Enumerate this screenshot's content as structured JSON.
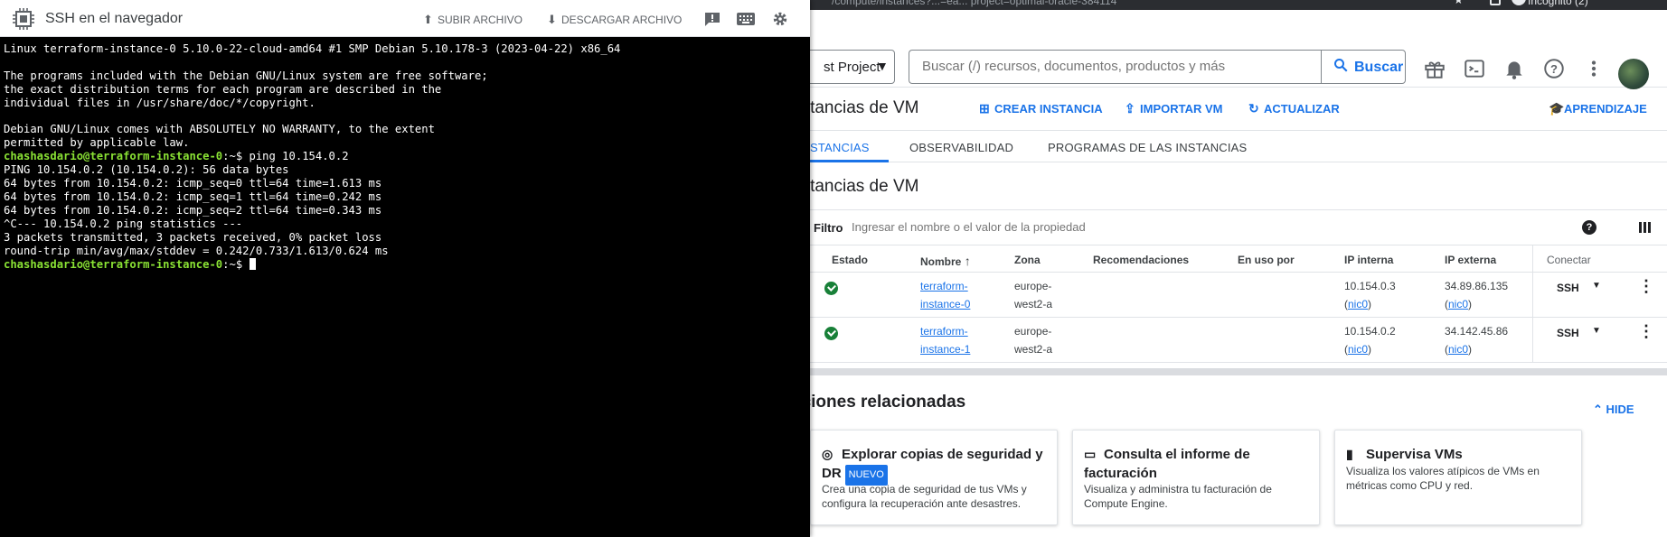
{
  "ssh_window": {
    "title": "SSH en el navegador",
    "upload_label": "SUBIR ARCHIVO",
    "download_label": "DESCARGAR ARCHIVO",
    "terminal": {
      "lines": [
        "Linux terraform-instance-0 5.10.0-22-cloud-amd64 #1 SMP Debian 5.10.178-3 (2023-04-22) x86_64",
        "",
        "The programs included with the Debian GNU/Linux system are free software;",
        "the exact distribution terms for each program are described in the",
        "individual files in /usr/share/doc/*/copyright.",
        "",
        "Debian GNU/Linux comes with ABSOLUTELY NO WARRANTY, to the extent",
        "permitted by applicable law."
      ],
      "prompt1": "chashasdario@terraform-instance-0",
      "prompt1_suffix": ":~$ ping 10.154.0.2",
      "ping_lines": [
        "PING 10.154.0.2 (10.154.0.2): 56 data bytes",
        "64 bytes from 10.154.0.2: icmp_seq=0 ttl=64 time=1.613 ms",
        "64 bytes from 10.154.0.2: icmp_seq=1 ttl=64 time=0.242 ms",
        "64 bytes from 10.154.0.2: icmp_seq=2 ttl=64 time=0.343 ms",
        "^C--- 10.154.0.2 ping statistics ---",
        "3 packets transmitted, 3 packets received, 0% packet loss",
        "round-trip min/avg/max/stddev = 0.242/0.733/1.613/0.624 ms"
      ],
      "prompt2": "chashasdario@terraform-instance-0",
      "prompt2_suffix": ":~$ "
    }
  },
  "browser": {
    "url_fragment": "/compute/instances?...=ea... project=optimal-oracle-384114",
    "profile": "Incógnito (2)"
  },
  "console": {
    "project_label": "st Project",
    "search_placeholder": "Buscar (/) recursos, documentos, productos y más",
    "search_button": "Buscar",
    "page_title": "nstancias de VM",
    "actions": {
      "create": "CREAR INSTANCIA",
      "import": "IMPORTAR VM",
      "refresh": "ACTUALIZAR",
      "learn": "APRENDIZAJE"
    },
    "tabs": [
      "STANCIAS",
      "OBSERVABILIDAD",
      "PROGRAMAS DE LAS INSTANCIAS"
    ],
    "section_title": "nstancias de VM",
    "filter_label": "Filtro",
    "filter_placeholder": "Ingresar el nombre o el valor de la propiedad",
    "table": {
      "headers": {
        "estado": "Estado",
        "nombre": "Nombre",
        "zona": "Zona",
        "recomendaciones": "Recomendaciones",
        "en_uso": "En uso por",
        "ip_interna": "IP interna",
        "ip_externa": "IP externa",
        "conectar": "Conectar"
      },
      "rows": [
        {
          "name_a": "terraform-",
          "name_b": "instance-0",
          "zone_a": "europe-",
          "zone_b": "west2-a",
          "ip_int": "10.154.0.3",
          "ip_ext": "34.89.86.135",
          "nic": "nic0",
          "connect": "SSH"
        },
        {
          "name_a": "terraform-",
          "name_b": "instance-1",
          "zone_a": "europe-",
          "zone_b": "west2-a",
          "ip_int": "10.154.0.2",
          "ip_ext": "34.142.45.86",
          "nic": "nic0",
          "connect": "SSH"
        }
      ]
    },
    "related": {
      "title": "cciones relacionadas",
      "hide": "HIDE",
      "cards": [
        {
          "title_a": "Explorar copias de seguridad y",
          "title_b": "DR",
          "badge": "NUEVO",
          "desc_a": "Crea una copia de seguridad de tus VMs y",
          "desc_b": "configura la recuperación ante desastres."
        },
        {
          "title_a": "Consulta el informe de",
          "title_b": "facturación",
          "desc_a": "Visualiza y administra tu facturación de",
          "desc_b": "Compute Engine."
        },
        {
          "title_a": "Supervisa VMs",
          "desc_a": "Visualiza los valores atípicos de VMs en",
          "desc_b": "métricas como CPU y red."
        }
      ]
    }
  },
  "colors": {
    "accent": "#1a73e8",
    "prompt": "#8ae234",
    "status_ok": "#188038"
  }
}
